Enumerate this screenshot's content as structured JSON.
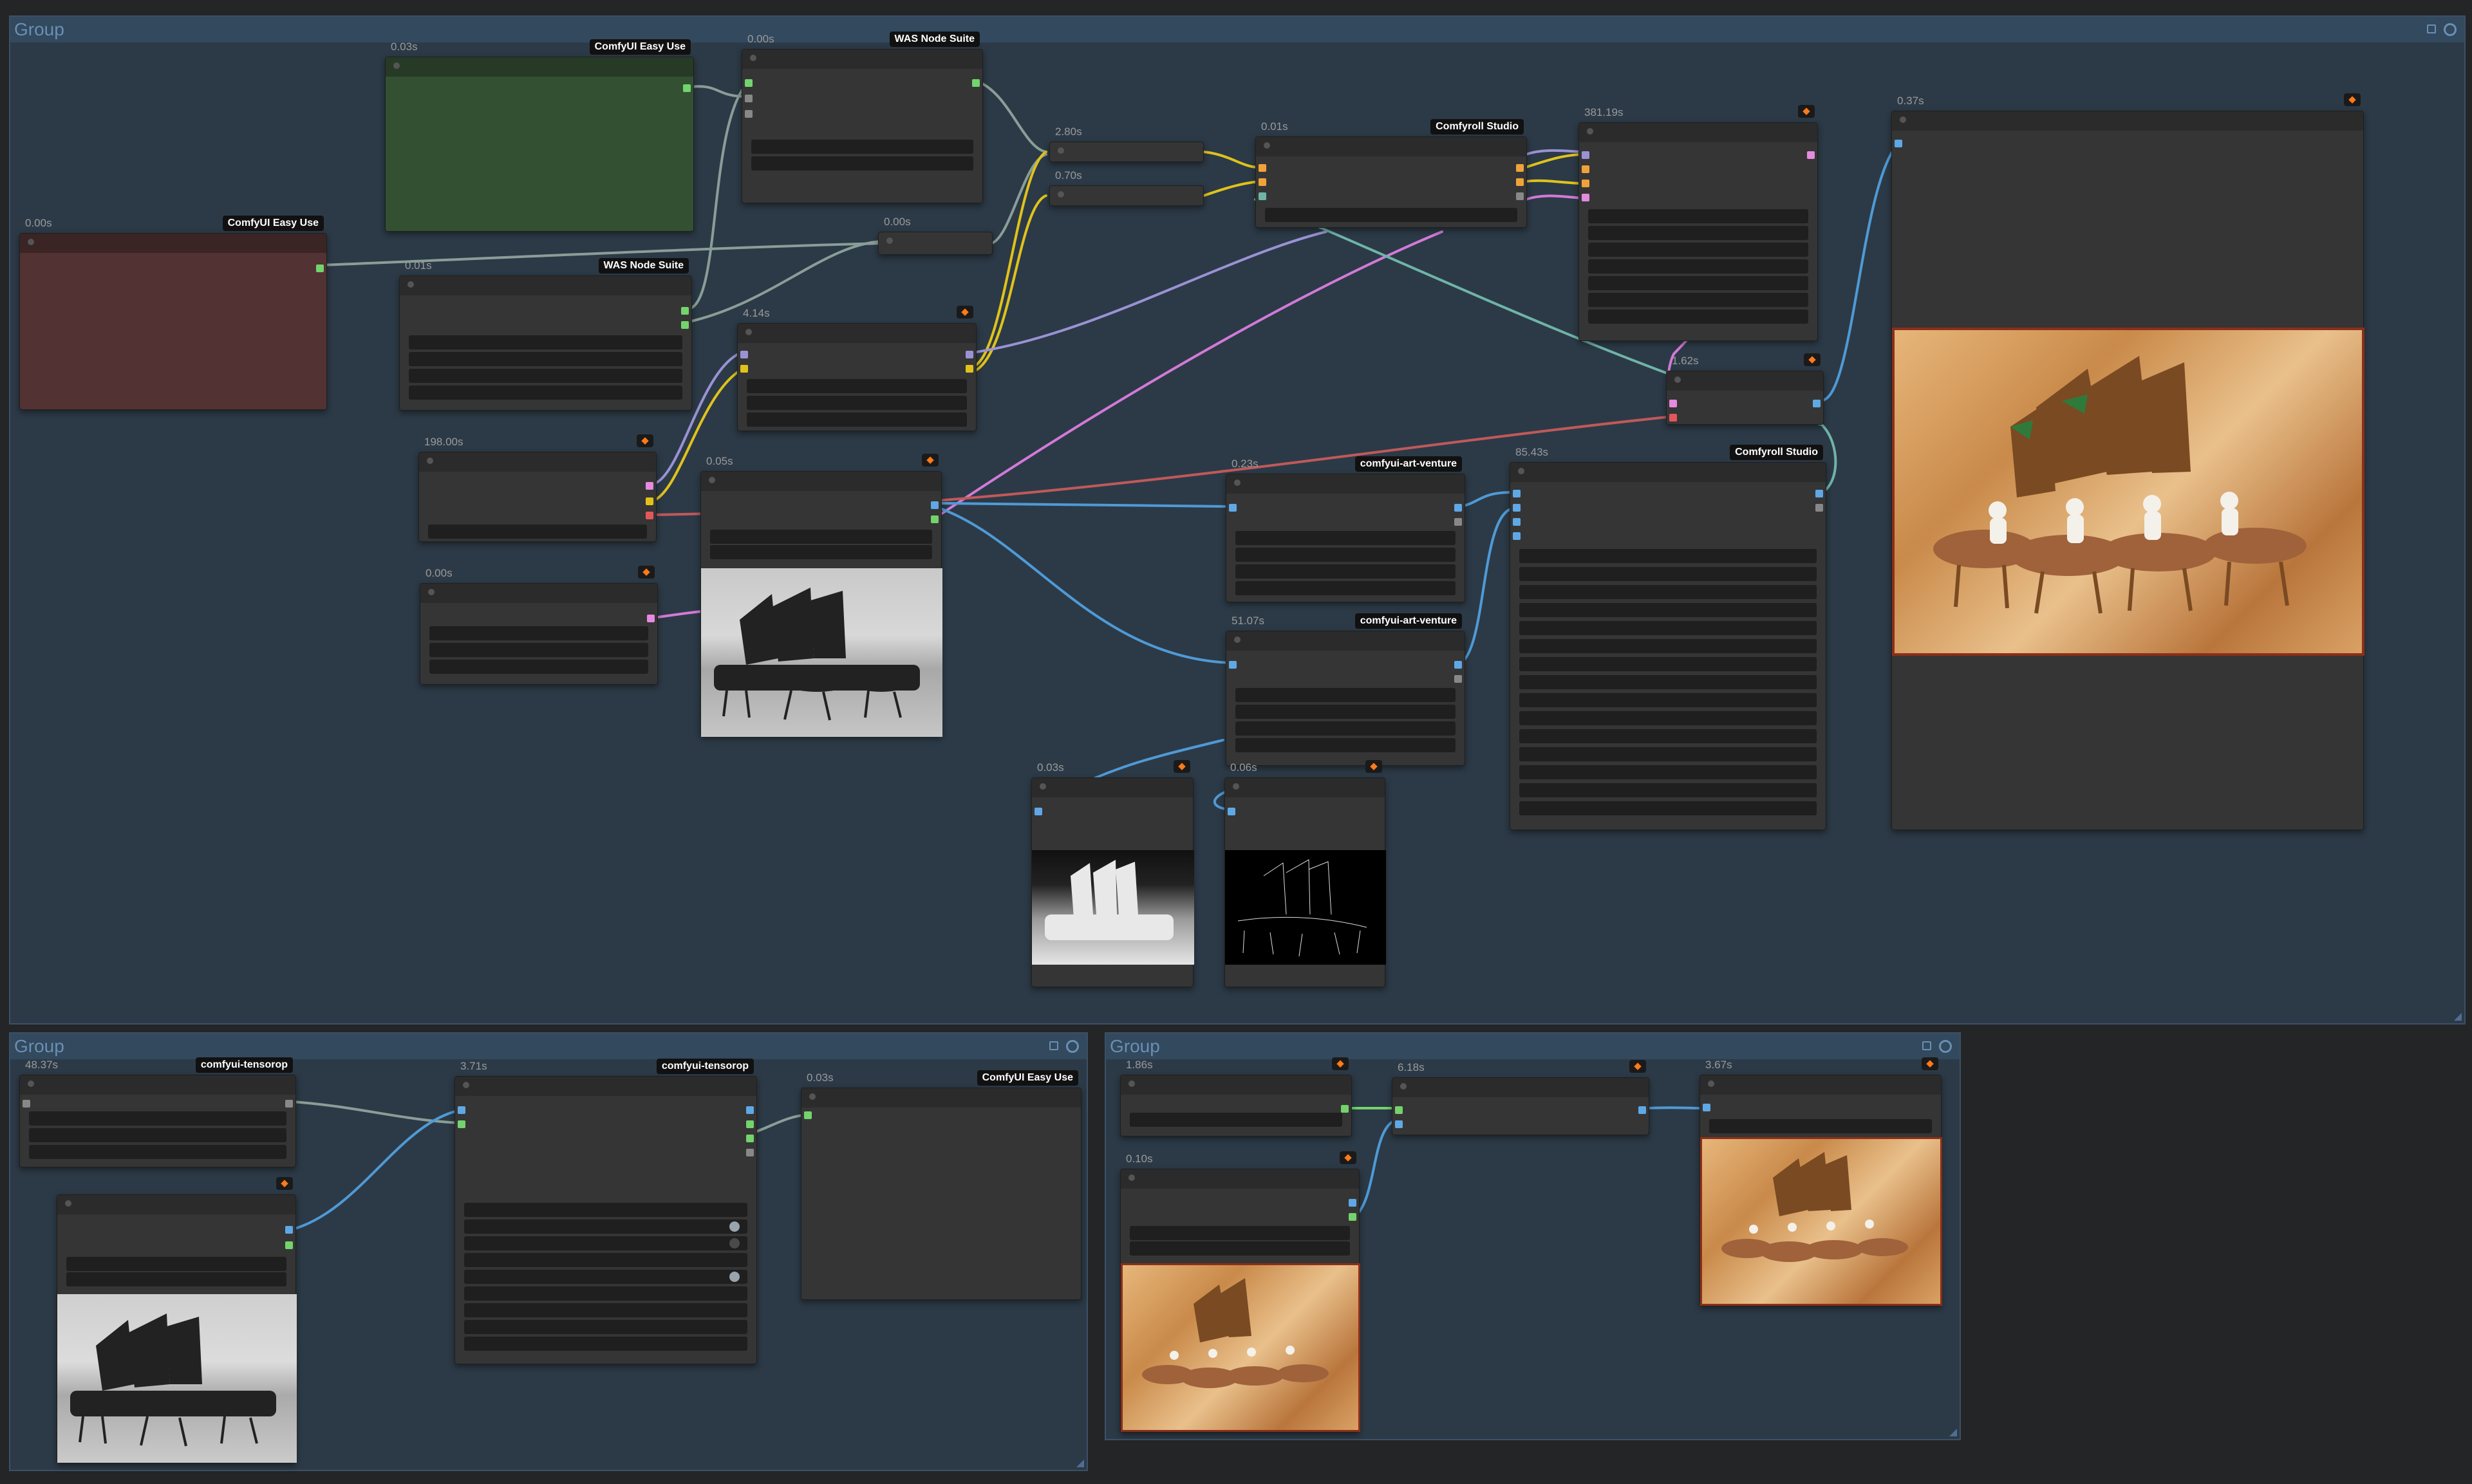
{
  "groups": [
    {
      "id": "g1",
      "title": "Group"
    },
    {
      "id": "g2",
      "title": "Group"
    },
    {
      "id": "g3",
      "title": "Group"
    }
  ],
  "nodes": [
    {
      "id": "n_easy_red",
      "time": "0.00s",
      "badge": "ComfyUI Easy Use",
      "color": "#5a2f2f"
    },
    {
      "id": "n_easy_green",
      "time": "0.03s",
      "badge": "ComfyUI Easy Use",
      "color": "#2f5a2f"
    },
    {
      "id": "n_was1",
      "time": "0.00s",
      "badge": "WAS Node Suite"
    },
    {
      "id": "n_was2",
      "time": "0.01s",
      "badge": "WAS Node Suite"
    },
    {
      "id": "n_reroute1",
      "time": "0.00s"
    },
    {
      "id": "n_mid414",
      "time": "4.14s",
      "fox": true
    },
    {
      "id": "n_198",
      "time": "198.00s",
      "fox": true
    },
    {
      "id": "n_000b",
      "time": "0.00s",
      "fox": true
    },
    {
      "id": "n_005",
      "time": "0.05s",
      "fox": true
    },
    {
      "id": "n_280",
      "time": "2.80s"
    },
    {
      "id": "n_070",
      "time": "0.70s"
    },
    {
      "id": "n_comfyroll1",
      "time": "0.01s",
      "badge": "Comfyroll Studio"
    },
    {
      "id": "n_381",
      "time": "381.19s",
      "fox": true
    },
    {
      "id": "n_162",
      "time": "1.62s",
      "fox": true
    },
    {
      "id": "n_037",
      "time": "0.37s",
      "fox": true
    },
    {
      "id": "n_art1",
      "time": "0.23s",
      "badge": "comfyui-art-venture"
    },
    {
      "id": "n_art2",
      "time": "51.07s",
      "badge": "comfyui-art-venture"
    },
    {
      "id": "n_comfyroll2",
      "time": "85.43s",
      "badge": "Comfyroll Studio"
    },
    {
      "id": "n_003a",
      "time": "0.03s",
      "fox": true
    },
    {
      "id": "n_006",
      "time": "0.06s",
      "fox": true
    },
    {
      "id": "n_tens1",
      "time": "48.37s",
      "badge": "comfyui-tensorop"
    },
    {
      "id": "n_load2",
      "time": "",
      "fox": true
    },
    {
      "id": "n_tens2",
      "time": "3.71s",
      "badge": "comfyui-tensorop"
    },
    {
      "id": "n_easy3",
      "time": "0.03s",
      "badge": "ComfyUI Easy Use"
    },
    {
      "id": "n_186",
      "time": "1.86s",
      "fox": true
    },
    {
      "id": "n_010",
      "time": "0.10s",
      "fox": true
    },
    {
      "id": "n_618",
      "time": "6.18s",
      "fox": true
    },
    {
      "id": "n_367",
      "time": "3.67s",
      "fox": true
    }
  ],
  "colors": {
    "wire_gray": "#8a9e98",
    "wire_yellow": "#e0c21b",
    "wire_blue": "#4f9ad6",
    "wire_pink": "#d27ad8",
    "wire_red": "#c0595a",
    "wire_teal": "#6fb4a8",
    "wire_lilac": "#9a92d4",
    "slot_green": "#73d36d",
    "slot_orange": "#f0a23a",
    "slot_blue": "#5fa8e6",
    "slot_pink": "#e48adf",
    "slot_red": "#e2575a"
  }
}
